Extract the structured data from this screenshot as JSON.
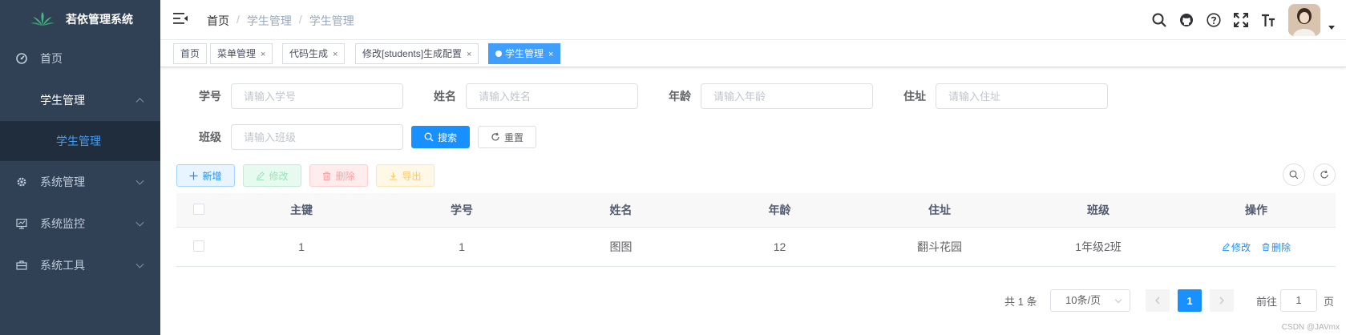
{
  "app": {
    "title": "若依管理系统"
  },
  "sidebar": {
    "items": [
      {
        "label": "首页",
        "icon": "dashboard-icon"
      },
      {
        "label": "学生管理",
        "icon": "",
        "expanded": true,
        "children": [
          {
            "label": "学生管理",
            "active": true
          }
        ]
      },
      {
        "label": "系统管理",
        "icon": "gear-icon"
      },
      {
        "label": "系统监控",
        "icon": "monitor-icon"
      },
      {
        "label": "系统工具",
        "icon": "toolbox-icon"
      }
    ]
  },
  "breadcrumb": [
    "首页",
    "学生管理",
    "学生管理"
  ],
  "header_icons": [
    "search-icon",
    "github-icon",
    "question-icon",
    "fullscreen-icon",
    "font-size-icon"
  ],
  "tags": [
    {
      "label": "首页",
      "closable": false,
      "active": false
    },
    {
      "label": "菜单管理",
      "closable": true,
      "active": false
    },
    {
      "label": "代码生成",
      "closable": true,
      "active": false
    },
    {
      "label": "修改[students]生成配置",
      "closable": true,
      "active": false
    },
    {
      "label": "学生管理",
      "closable": true,
      "active": true
    }
  ],
  "tag_close_glyph": "×",
  "search_form": {
    "fields": [
      {
        "label": "学号",
        "placeholder": "请输入学号"
      },
      {
        "label": "姓名",
        "placeholder": "请输入姓名"
      },
      {
        "label": "年龄",
        "placeholder": "请输入年龄"
      },
      {
        "label": "住址",
        "placeholder": "请输入住址"
      },
      {
        "label": "班级",
        "placeholder": "请输入班级"
      }
    ],
    "search_label": "搜索",
    "reset_label": "重置"
  },
  "toolbar": {
    "add_label": "新增",
    "edit_label": "修改",
    "delete_label": "删除",
    "export_label": "导出"
  },
  "table": {
    "columns": [
      "主键",
      "学号",
      "姓名",
      "年龄",
      "住址",
      "班级",
      "操作"
    ],
    "rows": [
      {
        "id": "1",
        "student_no": "1",
        "name": "图图",
        "age": "12",
        "address": "翻斗花园",
        "class": "1年级2班"
      }
    ],
    "row_actions": {
      "edit": "修改",
      "delete": "删除"
    }
  },
  "pagination": {
    "total_text": "共 1 条",
    "page_size": "10条/页",
    "current_page": "1",
    "goto_prefix": "前往",
    "goto_value": "1",
    "goto_suffix": "页"
  },
  "watermark": "CSDN @JAVmx",
  "colors": {
    "sidebar_bg": "#304156",
    "submenu_bg": "#1f2d3d",
    "primary": "#1890ff",
    "active_tag": "#409eff"
  }
}
